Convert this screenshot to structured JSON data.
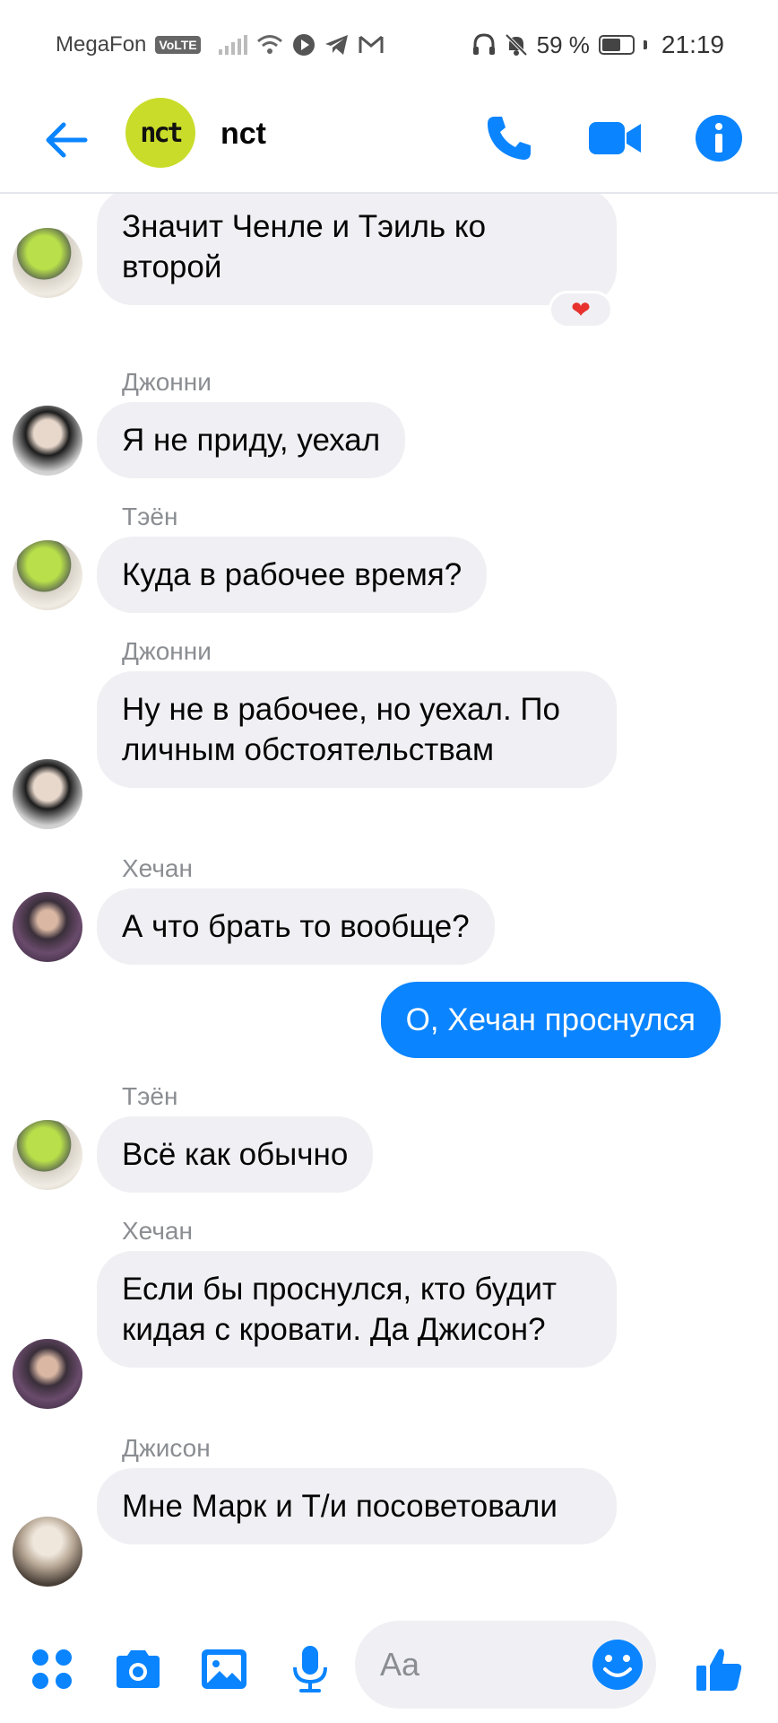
{
  "status_bar": {
    "carrier": "MegaFon",
    "network_badge": "VoLTE",
    "battery_percent": "59 %",
    "time": "21:19"
  },
  "header": {
    "group_name": "nct",
    "group_logo_text": "nct"
  },
  "messages": [
    {
      "type": "incoming",
      "sender": "",
      "avatar": "teyon",
      "text": "Значит Ченле и Тэиль ко второй",
      "reaction": "❤"
    },
    {
      "type": "incoming",
      "sender": "Джонни",
      "avatar": "johnny",
      "text": "Я не приду, уехал"
    },
    {
      "type": "incoming",
      "sender": "Тэён",
      "avatar": "teyon",
      "text": "Куда в рабочее время?"
    },
    {
      "type": "incoming",
      "sender": "Джонни",
      "avatar": "johnny",
      "text": "Ну не в рабочее, но уехал. По личным обстоятельствам"
    },
    {
      "type": "incoming",
      "sender": "Хечан",
      "avatar": "hechan",
      "text": "А что брать то вообще?"
    },
    {
      "type": "outgoing",
      "text": "О, Хечан проснулся"
    },
    {
      "type": "incoming",
      "sender": "Тэён",
      "avatar": "teyon",
      "text": "Всё как обычно"
    },
    {
      "type": "incoming",
      "sender": "Хечан",
      "avatar": "hechan",
      "text": "Если бы проснулся, кто будит кидая с кровати. Да Джисон?"
    },
    {
      "type": "incoming",
      "sender": "Джисон",
      "avatar": "jisung",
      "text": "Мне Марк и Т/и посоветовали"
    }
  ],
  "composer": {
    "placeholder": "Aa"
  },
  "colors": {
    "accent": "#0a84ff",
    "incoming_bubble": "#f0f0f4",
    "sender_label": "#8a8d91"
  },
  "icons": {
    "back": "arrow-left-icon",
    "call": "phone-icon",
    "video": "video-camera-icon",
    "info": "info-icon",
    "apps": "four-dots-icon",
    "camera": "camera-icon",
    "gallery": "image-icon",
    "mic": "microphone-icon",
    "emoji": "smiley-icon",
    "like": "thumbs-up-icon"
  }
}
